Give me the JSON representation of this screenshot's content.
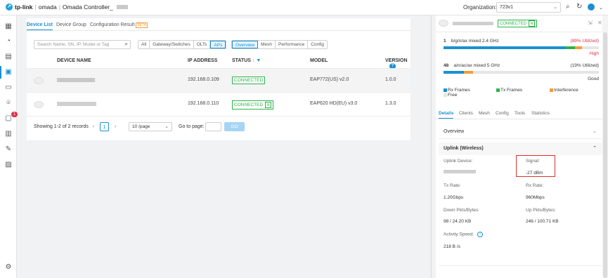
{
  "header": {
    "brand": "tp-link",
    "product": "omada",
    "controller": "Omada Controller_",
    "org_label": "Organization:",
    "org_value": "723v1"
  },
  "sidebar": {
    "badge": "1",
    "items": [
      "dashboard-icon",
      "statistics-icon",
      "map-icon",
      "devices-icon",
      "clients-icon",
      "location-icon",
      "alerts-icon",
      "logs-icon",
      "tools-icon",
      "reports-icon",
      "settings-icon"
    ]
  },
  "main": {
    "tabs": [
      "Device List",
      "Device Group",
      "Configuration Result"
    ],
    "beta": "BETA",
    "search_placeholder": "Search Name, SN, IP, Model or Tag",
    "filters": [
      "All",
      "Gateway/Switches",
      "OLTs",
      "APs"
    ],
    "views": [
      "Overview",
      "Mesh",
      "Performance",
      "Config"
    ],
    "columns": [
      "DEVICE NAME",
      "IP ADDRESS",
      "STATUS",
      "MODEL",
      "VERSION"
    ],
    "rows": [
      {
        "ip": "192.168.0.109",
        "status": "CONNECTED",
        "model": "EAP772(US) v2.0",
        "version": "1.0.0"
      },
      {
        "ip": "192.168.0.110",
        "status": "CONNECTED",
        "model": "EAP620 HD(EU) v3.0",
        "version": "1.3.0"
      }
    ],
    "pager": {
      "showing": "Showing 1-2 of 2 records",
      "page": "1",
      "per_page": "10 /page",
      "goto_label": "Go to page:",
      "go": "GO"
    }
  },
  "detail": {
    "status": "CONNECTED",
    "radios": [
      {
        "channel": "1",
        "mode": "b/g/n/ax mixed  2.4 GHz",
        "util": "(89% Utilized)",
        "level": "High",
        "util_color": "#e0304a",
        "fill": 0.89
      },
      {
        "channel": "48",
        "mode": "a/n/ac/ax mixed  5 GHz",
        "util": "(19% Utilized)",
        "level": "Good",
        "util_color": "#333333",
        "fill": 0.19
      }
    ],
    "legend": [
      "Rx Frames",
      "Tx Frames",
      "Interference",
      "Free"
    ],
    "legend_colors": [
      "#1a8fd3",
      "#2db24a",
      "#f39c3a",
      "#e5e5e5"
    ],
    "tabs": [
      "Details",
      "Clients",
      "Mesh",
      "Config",
      "Tools",
      "Statistics"
    ],
    "overview": "Overview",
    "uplink_title": "Uplink (Wireless)",
    "fields": {
      "uplink_device_label": "Uplink Device:",
      "signal_label": "Signal:",
      "signal_value": "-27 dBm",
      "tx_label": "Tx Rate:",
      "tx_value": "1.20Gbps",
      "rx_label": "Rx Rate:",
      "rx_value": "960Mbps",
      "down_label": "Down Pkts/Bytes:",
      "down_value": "98 / 24.20 KB",
      "up_label": "Up Pkts/Bytes:",
      "up_value": "246 / 100.71 KB",
      "activity_label": "Activity Speed:",
      "activity_value": "218 B /s"
    }
  }
}
